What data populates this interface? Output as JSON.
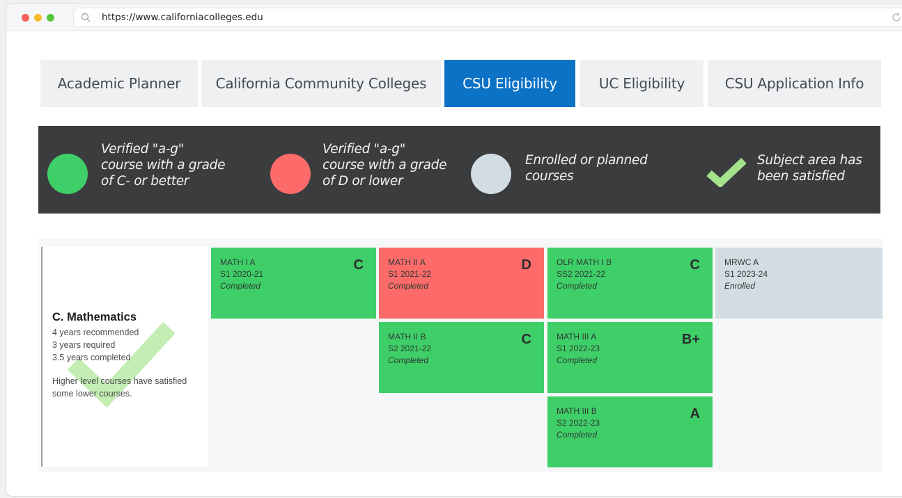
{
  "browser": {
    "url": "https://www.californiacolleges.edu"
  },
  "tabs": [
    {
      "label": "Academic Planner",
      "active": false
    },
    {
      "label": "California Community Colleges",
      "active": false
    },
    {
      "label": "CSU Eligibility",
      "active": true
    },
    {
      "label": "UC Eligibility",
      "active": false
    },
    {
      "label": "CSU Application Info",
      "active": false
    }
  ],
  "legend": {
    "items": [
      {
        "lines": [
          "Verified \"a-g\"",
          "course with a grade",
          "of C- or better"
        ],
        "color": "#3fcf68"
      },
      {
        "lines": [
          "Verified \"a-g\"",
          "course with a grade",
          "of D or lower"
        ],
        "color": "#fc6b6a"
      },
      {
        "lines": [
          "Enrolled or planned",
          "courses"
        ],
        "color": "#d2dde3"
      },
      {
        "lines": [
          "Subject area has",
          "been satisfied"
        ],
        "color": "#a6e28d"
      }
    ]
  },
  "subject": {
    "title": "C. Mathematics",
    "recommended": "4 years recommended",
    "required": "3 years required",
    "completed": "3.5 years completed",
    "note_line1": "Higher level courses have satisfied",
    "note_line2": "some lower courses."
  },
  "courses": [
    {
      "code": "MATH I A",
      "term": "S1 2020-21",
      "status": "Completed",
      "grade": "C",
      "color": "green"
    },
    {
      "code": "MATH II A",
      "term": "S1 2021-22",
      "status": "Completed",
      "grade": "D",
      "color": "red"
    },
    {
      "code": "OLR MATH I B",
      "term": "SS2 2021-22",
      "status": "Completed",
      "grade": "C",
      "color": "green"
    },
    {
      "code": "MRWC A",
      "term": "S1 2023-24",
      "status": "Enrolled",
      "grade": "",
      "color": "gray"
    },
    {
      "code": "MATH II B",
      "term": "S2 2021-22",
      "status": "Completed",
      "grade": "C",
      "color": "green"
    },
    {
      "code": "MATH III A",
      "term": "S1 2022-23",
      "status": "Completed",
      "grade": "B+",
      "color": "green"
    },
    {
      "code": "MATH III B",
      "term": "S2 2022-23",
      "status": "Completed",
      "grade": "A",
      "color": "green"
    }
  ]
}
